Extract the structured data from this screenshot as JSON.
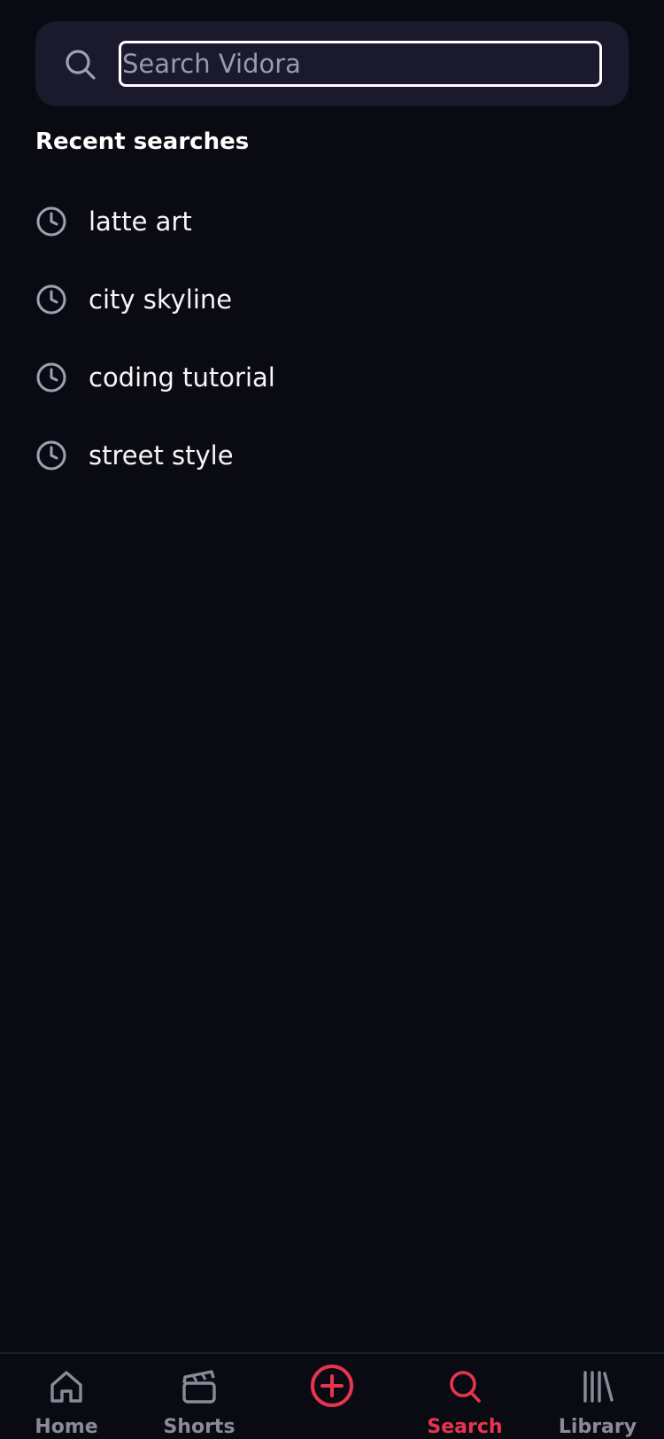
{
  "search": {
    "placeholder": "Search Vidora",
    "value": ""
  },
  "recent": {
    "title": "Recent searches",
    "items": [
      {
        "label": "latte art"
      },
      {
        "label": "city skyline"
      },
      {
        "label": "coding tutorial"
      },
      {
        "label": "street style"
      }
    ]
  },
  "tabs": [
    {
      "label": "Home",
      "icon": "home-icon",
      "active": false
    },
    {
      "label": "Shorts",
      "icon": "clapperboard-icon",
      "active": false
    },
    {
      "label": "",
      "icon": "create-plus-icon",
      "active": false
    },
    {
      "label": "Search",
      "icon": "search-icon",
      "active": true
    },
    {
      "label": "Library",
      "icon": "library-icon",
      "active": false
    }
  ],
  "colors": {
    "background": "#0a0b12",
    "search_bar": "#1a1a2c",
    "accent": "#e8344f",
    "muted_icon": "#8a8a99",
    "clock_icon": "#a09fb3"
  }
}
